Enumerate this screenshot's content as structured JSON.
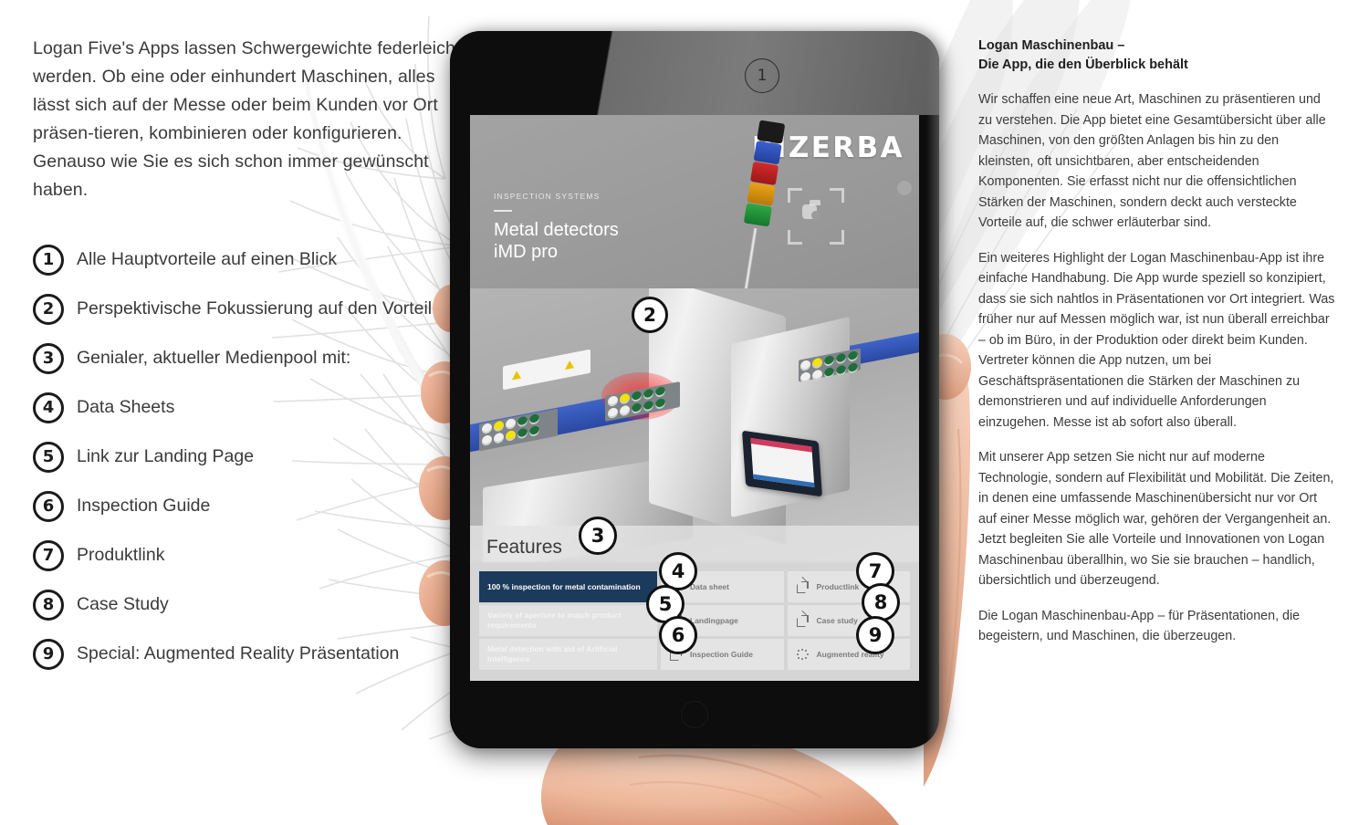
{
  "left": {
    "intro": "Logan Five's Apps lassen Schwergewichte federleicht werden. Ob eine oder einhundert Maschinen, alles lässt sich auf der Messe oder beim Kunden vor Ort präsen-tieren, kombinieren oder konfigurieren. Genauso wie Sie es sich schon immer gewünscht haben.",
    "legend": [
      {
        "num": "1",
        "label": "Alle Hauptvorteile auf einen Blick"
      },
      {
        "num": "2",
        "label": "Perspektivische Fokussierung auf den Vorteil"
      },
      {
        "num": "3",
        "label": "Genialer, aktueller Medienpool mit:"
      },
      {
        "num": "4",
        "label": "Data Sheets"
      },
      {
        "num": "5",
        "label": "Link zur Landing Page"
      },
      {
        "num": "6",
        "label": "Inspection Guide"
      },
      {
        "num": "7",
        "label": "Produktlink"
      },
      {
        "num": "8",
        "label": "Case Study"
      },
      {
        "num": "9",
        "label": "Special: Augmented Reality Präsentation"
      }
    ]
  },
  "tablet": {
    "brand": "BIZERBA",
    "eyebrow": "INSPECTION SYSTEMS",
    "hero_title_line1": "Metal detectors",
    "hero_title_line2": "iMD pro",
    "features_heading": "Features",
    "feature_items": [
      "100 % inspection for metal contamination",
      "Variety of aperture to match product requirements",
      "Metal detection with aid of Artificial Intelligence"
    ],
    "links_col1": [
      {
        "label": "Data sheet",
        "icon": "external-link-icon"
      },
      {
        "label": "Landingpage",
        "icon": "external-link-icon"
      },
      {
        "label": "Inspection Guide",
        "icon": "external-link-icon"
      }
    ],
    "links_col2": [
      {
        "label": "Productlink",
        "icon": "external-link-icon"
      },
      {
        "label": "Case study",
        "icon": "external-link-icon"
      },
      {
        "label": "Augmented reality",
        "icon": "augmented-reality-icon"
      }
    ],
    "callouts": {
      "c1": "1",
      "c2": "2",
      "c3": "3",
      "c4": "4",
      "c5": "5",
      "c6": "6",
      "c7": "7",
      "c8": "8",
      "c9": "9"
    }
  },
  "right": {
    "title_line1": "Logan Maschinenbau –",
    "title_line2": "Die App, die den Überblick behält",
    "paragraphs": [
      "Wir schaffen eine neue Art, Maschinen zu präsentieren und zu verstehen. Die App bietet eine Gesamtübersicht über alle Maschinen, von den größten Anlagen bis hin zu den kleinsten, oft unsichtbaren, aber entscheidenden Komponenten. Sie erfasst nicht nur die offensichtlichen Stärken der Maschinen, sondern deckt auch versteckte Vorteile auf, die schwer erläuterbar sind.",
      "Ein weiteres Highlight der Logan Maschinenbau-App ist ihre einfache Handhabung. Die App wurde speziell so konzipiert, dass sie sich nahtlos in Präsentationen vor Ort integriert. Was früher nur auf Messen möglich war, ist nun überall erreichbar – ob im Büro, in der Produktion oder direkt beim Kunden. Vertreter können die App nutzen, um bei Geschäftspräsentationen die Stärken der Maschinen zu demonstrieren und auf individuelle Anforderungen einzugehen. Messe ist ab sofort also überall.",
      "Mit unserer App setzen Sie nicht nur auf moderne Technologie, sondern auf Flexibilität und Mobilität. Die Zeiten, in denen eine umfassende Maschinenübersicht nur vor Ort auf einer Messe möglich war, gehören der Vergangenheit an. Jetzt begleiten Sie alle Vorteile und Innovationen von Logan Maschinenbau überallhin, wo Sie sie brauchen – handlich, übersichtlich und überzeugend.",
      "Die Logan Maschinenbau-App – für Präsentationen, die begeistern, und Maschinen, die überzeugen."
    ]
  },
  "colors": {
    "accent_navy": "#1b3a5c",
    "badge_outline": "#111111",
    "text": "#3c3c3c",
    "screen_grey": "#9b9b9b"
  }
}
